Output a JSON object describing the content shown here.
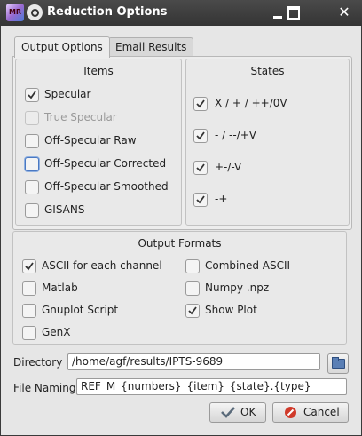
{
  "window": {
    "title": "Reduction Options",
    "app_icon_text": "MR"
  },
  "tabs": [
    {
      "label": "Output Options",
      "active": true
    },
    {
      "label": "Email Results",
      "active": false
    }
  ],
  "items": {
    "title": "Items",
    "options": [
      {
        "label": "Specular",
        "checked": true,
        "enabled": true
      },
      {
        "label": "True Specular",
        "checked": false,
        "enabled": false
      },
      {
        "label": "Off-Specular Raw",
        "checked": false,
        "enabled": true
      },
      {
        "label": "Off-Specular Corrected",
        "checked": false,
        "enabled": true,
        "focused": true
      },
      {
        "label": "Off-Specular Smoothed",
        "checked": false,
        "enabled": true
      },
      {
        "label": "GISANS",
        "checked": false,
        "enabled": true
      }
    ]
  },
  "states": {
    "title": "States",
    "options": [
      {
        "label": "X / + / ++/0V",
        "checked": true
      },
      {
        "label": "- / --/+V",
        "checked": true
      },
      {
        "label": "+-/-V",
        "checked": true
      },
      {
        "label": "-+",
        "checked": true
      }
    ]
  },
  "output_formats": {
    "title": "Output Formats",
    "left": [
      {
        "label": "ASCII for each channel",
        "checked": true
      },
      {
        "label": "Matlab",
        "checked": false
      },
      {
        "label": "Gnuplot Script",
        "checked": false
      },
      {
        "label": "GenX",
        "checked": false
      }
    ],
    "right": [
      {
        "label": "Combined ASCII",
        "checked": false
      },
      {
        "label": "Numpy .npz",
        "checked": false
      },
      {
        "label": "Show Plot",
        "checked": true
      }
    ]
  },
  "directory": {
    "label": "Directory",
    "value": "/home/agf/results/IPTS-9689"
  },
  "file_naming": {
    "label": "File Naming",
    "value": "REF_M_{numbers}_{item}_{state}.{type}"
  },
  "buttons": {
    "ok": "OK",
    "cancel": "Cancel"
  },
  "colors": {
    "accent": "#4a78c2",
    "cancel_icon": "#d03a2a"
  }
}
